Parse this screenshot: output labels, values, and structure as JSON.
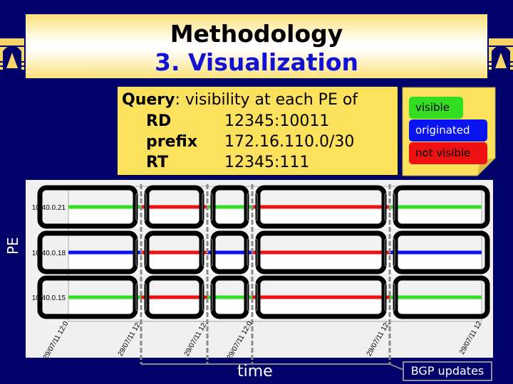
{
  "header": {
    "title": "Methodology",
    "subtitle": "3. Visualization"
  },
  "emblems": [
    "arch-emblem-icon",
    "arch-emblem-icon"
  ],
  "query": {
    "label": "Query",
    "text": ": visibility at each PE of",
    "fields": [
      {
        "key": "RD",
        "value": "12345:10011"
      },
      {
        "key": "prefix",
        "value": "172.16.110.0/30"
      },
      {
        "key": "RT",
        "value": "12345:111"
      }
    ]
  },
  "legend": {
    "items": [
      {
        "label": "visible",
        "color": "#33dd22",
        "text_color": "#000000"
      },
      {
        "label": "originated",
        "color": "#0a14f0",
        "text_color": "#ffffff"
      },
      {
        "label": "not visible",
        "color": "#ee1111",
        "text_color": "#000000"
      }
    ]
  },
  "axis": {
    "y_label": "PE",
    "x_label": "time",
    "callout": "BGP updates"
  },
  "chart_data": {
    "type": "timeline",
    "rows": [
      {
        "pe": "10.40.0.21",
        "segments": [
          {
            "from": 0,
            "to": 1,
            "state": "visible"
          },
          {
            "from": 1,
            "to": 2,
            "state": "not visible"
          },
          {
            "from": 2,
            "to": 3,
            "state": "visible"
          },
          {
            "from": 3,
            "to": 4,
            "state": "not visible"
          },
          {
            "from": 4,
            "to": 5,
            "state": "visible"
          }
        ]
      },
      {
        "pe": "10.40.0.18",
        "segments": [
          {
            "from": 0,
            "to": 1,
            "state": "originated"
          },
          {
            "from": 1,
            "to": 2,
            "state": "not visible"
          },
          {
            "from": 2,
            "to": 3,
            "state": "originated"
          },
          {
            "from": 3,
            "to": 4,
            "state": "not visible"
          },
          {
            "from": 4,
            "to": 5,
            "state": "originated"
          }
        ]
      },
      {
        "pe": "10.40.0.15",
        "segments": [
          {
            "from": 0,
            "to": 1,
            "state": "visible"
          },
          {
            "from": 1,
            "to": 2,
            "state": "not visible"
          },
          {
            "from": 2,
            "to": 3,
            "state": "visible"
          },
          {
            "from": 3,
            "to": 4,
            "state": "not visible"
          },
          {
            "from": 4,
            "to": 5,
            "state": "visible"
          }
        ]
      }
    ],
    "x_ticks": [
      "29/07/11 12:0",
      "29/07/11 12:",
      "29/07/11 12:",
      "29/07/11 12:0",
      "29/07/11 12:",
      "29/07/11 12"
    ],
    "bgp_updates": [
      1,
      2,
      3,
      4
    ],
    "x_label": "time",
    "y_label": "PE"
  }
}
